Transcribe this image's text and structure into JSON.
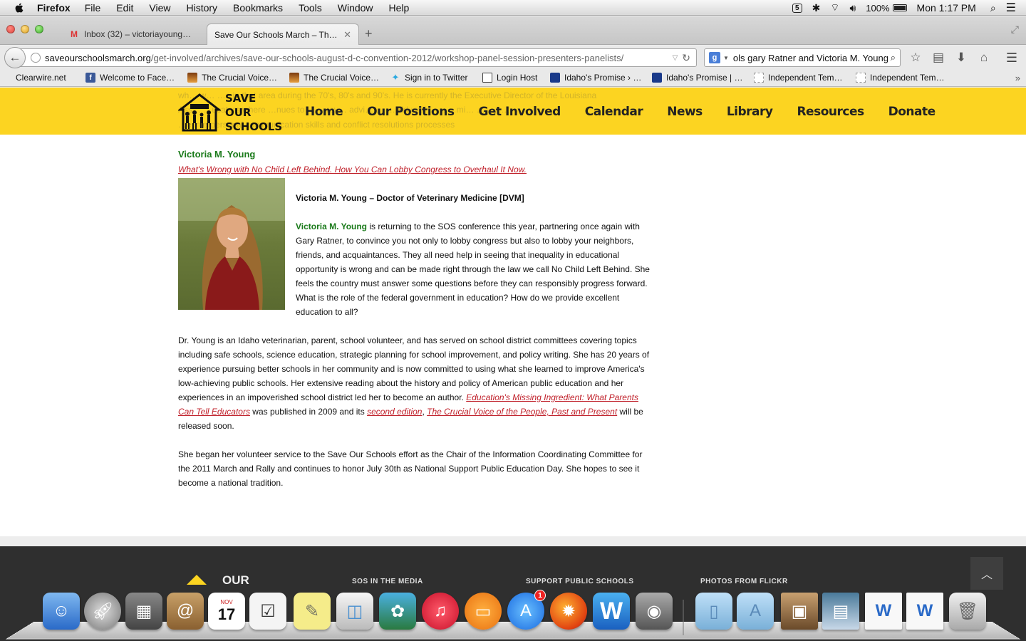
{
  "menubar": {
    "app": "Firefox",
    "items": [
      "File",
      "Edit",
      "View",
      "History",
      "Bookmarks",
      "Tools",
      "Window",
      "Help"
    ],
    "battery": "100%",
    "clock": "Mon 1:17 PM"
  },
  "tabs": [
    {
      "label": "Inbox (32) – victoriayoung…",
      "icon": "gmail-icon"
    },
    {
      "label": "Save Our Schools March – The…",
      "icon": "page-icon"
    }
  ],
  "urlbar": {
    "domain": "saveourschoolsmarch.org",
    "path": "/get-involved/archives/save-our-schools-august-d-c-convention-2012/workshop-panel-session-presenters-panelists/"
  },
  "search": {
    "query": "ols gary Ratner and Victoria M. Young"
  },
  "bookmarks": [
    {
      "label": "Clearwire.net",
      "icon": "none"
    },
    {
      "label": "Welcome to Face…",
      "icon": "facebook"
    },
    {
      "label": "The Crucial Voice…",
      "icon": "image"
    },
    {
      "label": "The Crucial Voice…",
      "icon": "image"
    },
    {
      "label": "Sign in to Twitter",
      "icon": "twitter"
    },
    {
      "label": "Login Host",
      "icon": "host"
    },
    {
      "label": "Idaho's Promise › …",
      "icon": "idaho"
    },
    {
      "label": "Idaho's Promise | …",
      "icon": "idaho"
    },
    {
      "label": "Independent Tem…",
      "icon": "blank"
    },
    {
      "label": "Independent Tem…",
      "icon": "blank"
    }
  ],
  "site": {
    "bleed_lines": [
      "wh… w…   …e in that area during the 70's, 80's and 90's. He is currently the Executive Director of the Louisiana",
      "Ass…  …ucators where    …nues to … …rov…  advi… … … Educati…  … …mi… … …  …t",
      "      …e interpersonal communication skills and conflict resolutions processes"
    ],
    "logo_lines": [
      "SAVE",
      "OUR",
      "SCHOOLS"
    ],
    "nav": [
      "Home",
      "Our Positions",
      "Get Involved",
      "Calendar",
      "News",
      "Library",
      "Resources",
      "Donate"
    ]
  },
  "article": {
    "name": "Victoria M. Young",
    "session_title": "What's Wrong with No Child Left Behind. How You Can Lobby Congress to Overhaul It Now.",
    "credential": "Victoria M. Young – Doctor of Veterinary Medicine [DVM]",
    "p1_name": "Victoria M. Young",
    "p1_rest": " is returning to the SOS conference this year, partnering once again with Gary Ratner, to convince you not only to lobby congress but also to lobby your neighbors, friends, and acquaintances. They all need help in seeing that inequality in educational opportunity is wrong and can be made right through the law we call No Child Left Behind. She feels the country must answer some questions before they can responsibly progress forward. What is the role of the federal government in education? How do we provide excellent education to all?",
    "p2_start": "Dr. Young is an Idaho veterinarian, parent, school volunteer, and has served on school district committees covering topics including safe schools, science education, strategic planning for school improvement, and policy writing. She has 20 years of experience pursuing better schools in her community and is now committed to using what she learned to improve America's low-achieving public schools. Her extensive reading about the history and policy of American public education and her experiences in an impoverished school district led her to become an author. ",
    "p2_link1": "Education's Missing Ingredient: What Parents Can Tell Educators",
    "p2_mid": " was published in 2009 and its ",
    "p2_link2": "second edition",
    "p2_comma": ", ",
    "p2_link3": "The Crucial Voice of the People, Past and Present",
    "p2_end": " will be released soon.",
    "p3": "She began her volunteer service to the Save Our Schools effort as the Chair of the Information Coordinating Committee for the 2011 March and Rally and continues to honor July 30th as National Support Public Education Day. She hopes to see it become a national tradition."
  },
  "footer": {
    "our": "OUR",
    "headings": [
      "SOS IN THE MEDIA",
      "SUPPORT PUBLIC SCHOOLS",
      "PHOTOS FROM FLICKR"
    ]
  },
  "dock": {
    "calendar_month": "NOV",
    "calendar_day": "17",
    "appstore_badge": "1",
    "items": [
      "finder",
      "launchpad",
      "image-capture",
      "contacts",
      "calendar",
      "reminders",
      "stickies",
      "preview",
      "iphoto",
      "itunes",
      "ibooks",
      "app-store",
      "firefox",
      "word",
      "photo-booth",
      "documents-folder",
      "applications-folder",
      "photo-stack",
      "screenshot",
      "word-doc",
      "word-doc-2",
      "trash"
    ]
  }
}
